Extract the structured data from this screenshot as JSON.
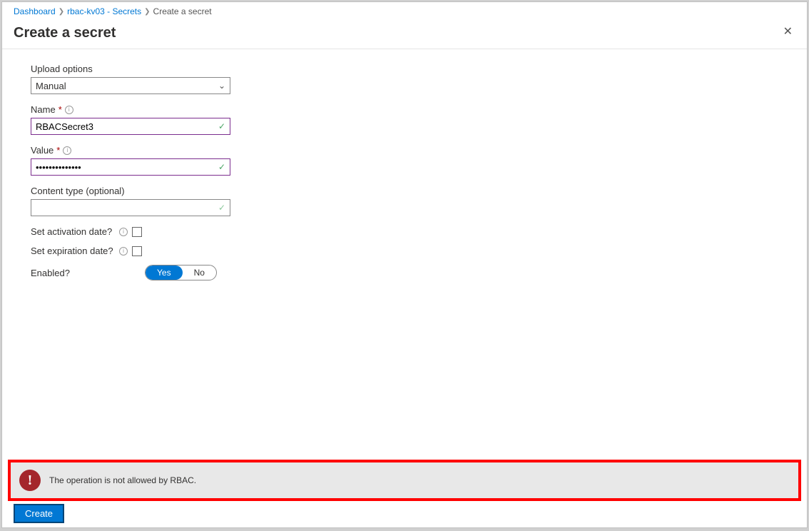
{
  "breadcrumb": {
    "items": [
      "Dashboard",
      "rbac-kv03 - Secrets"
    ],
    "current": "Create a secret"
  },
  "header": {
    "title": "Create a secret"
  },
  "form": {
    "upload": {
      "label": "Upload options",
      "value": "Manual"
    },
    "name": {
      "label": "Name",
      "value": "RBACSecret3"
    },
    "value": {
      "label": "Value",
      "value": "••••••••••••••"
    },
    "contentType": {
      "label": "Content type (optional)",
      "value": ""
    },
    "activation": {
      "label": "Set activation date?"
    },
    "expiration": {
      "label": "Set expiration date?"
    },
    "enabled": {
      "label": "Enabled?",
      "yes": "Yes",
      "no": "No"
    }
  },
  "error": {
    "message": "The operation is not allowed by RBAC."
  },
  "footer": {
    "create": "Create"
  }
}
